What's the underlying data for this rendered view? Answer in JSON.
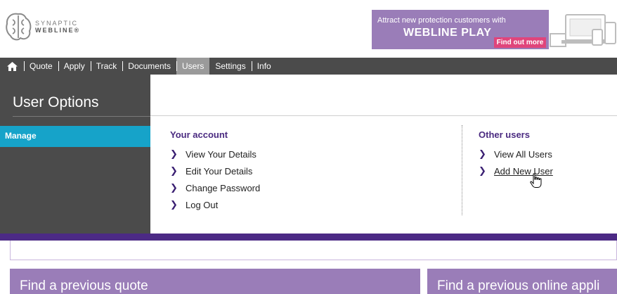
{
  "brand": {
    "line1": "SYNAPTIC",
    "line2": "WEBLINE®"
  },
  "banner": {
    "tagline": "Attract new protection customers with",
    "product": "WEBLINE PLAY",
    "cta": "Find out more"
  },
  "nav": {
    "items": [
      {
        "label": "Quote"
      },
      {
        "label": "Apply"
      },
      {
        "label": "Track"
      },
      {
        "label": "Documents"
      },
      {
        "label": "Users"
      },
      {
        "label": "Settings"
      },
      {
        "label": "Info"
      }
    ],
    "active": "Users"
  },
  "panel": {
    "title": "User Options",
    "side_item": "Manage",
    "your_account": {
      "heading": "Your account",
      "links": [
        "View Your Details",
        "Edit Your Details",
        "Change Password",
        "Log Out"
      ]
    },
    "other_users": {
      "heading": "Other users",
      "links": [
        "View All Users",
        "Add New User"
      ]
    }
  },
  "cards": {
    "quote": "Find a previous quote",
    "application": "Find a previous online appli"
  },
  "colors": {
    "purple": "#9a7db8",
    "dark_purple": "#4c2a85",
    "nav_bg": "#4b4b4b",
    "accent_blue": "#16a3c9",
    "cta_pink": "#e0457b"
  }
}
